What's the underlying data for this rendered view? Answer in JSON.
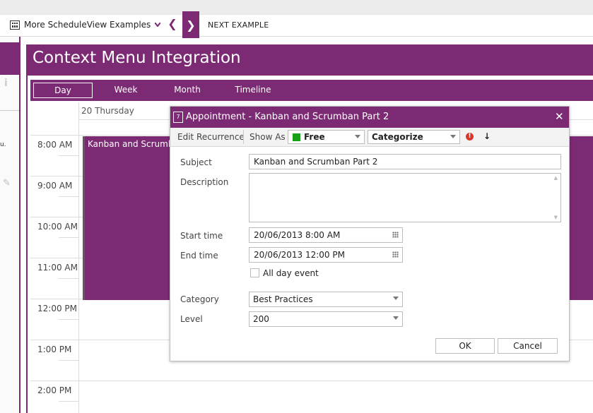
{
  "topbar": {
    "examples_label": "More ScheduleView Examples",
    "next_example_label": "NEXT EXAMPLE",
    "prev_glyph": "❮",
    "next_glyph": "❯"
  },
  "page": {
    "title": "Context Menu Integration"
  },
  "view_tabs": [
    {
      "label": "Day"
    },
    {
      "label": "Week"
    },
    {
      "label": "Month"
    },
    {
      "label": "Timeline"
    }
  ],
  "scheduler": {
    "day_header": "20 Thursday",
    "time_slots": [
      "8:00 AM",
      "9:00 AM",
      "10:00 AM",
      "11:00 AM",
      "12:00 PM",
      "1:00 PM",
      "2:00 PM"
    ],
    "appointment_title": "Kanban and Scrumban"
  },
  "dialog": {
    "title": "Appointment - Kanban and Scrumban Part 2",
    "close_glyph": "✕",
    "toolbar": {
      "edit_recurrence": "Edit Recurrence",
      "show_as_label": "Show As",
      "show_as_value": "Free",
      "categorize_label": "Categorize",
      "high_importance_glyph": "!",
      "low_importance_glyph": "↓"
    },
    "fields": {
      "subject_label": "Subject",
      "subject_value": "Kanban and Scrumban Part 2",
      "description_label": "Description",
      "description_value": "",
      "start_label": "Start time",
      "start_value": "20/06/2013 8:00 AM",
      "end_label": "End time",
      "end_value": "20/06/2013 12:00 PM",
      "all_day_label": "All day event",
      "all_day_checked": false,
      "category_label": "Category",
      "category_value": "Best Practices",
      "level_label": "Level",
      "level_value": "200"
    },
    "buttons": {
      "ok": "OK",
      "cancel": "Cancel"
    }
  },
  "colors": {
    "accent": "#7b2a73",
    "free_status": "#18a018",
    "high_importance": "#d9372a"
  }
}
